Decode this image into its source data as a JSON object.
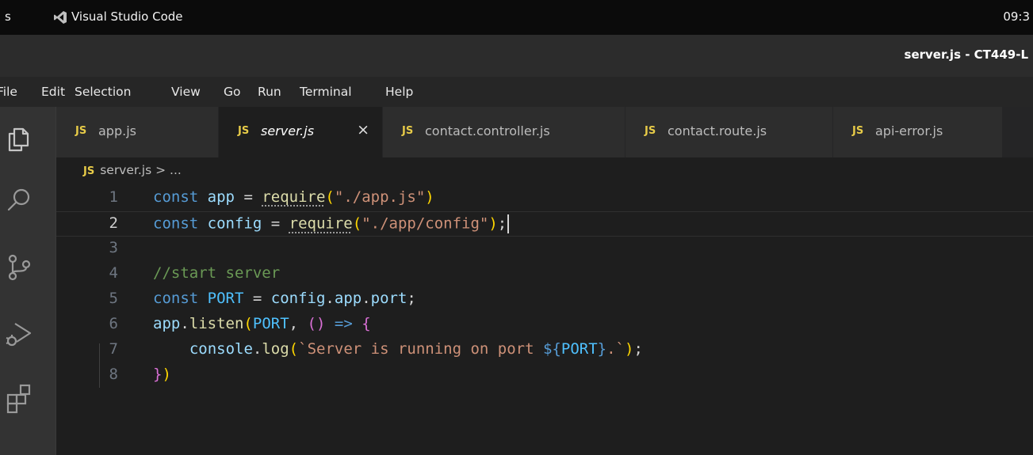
{
  "topbar": {
    "activities": "s",
    "app_name": "Visual Studio Code",
    "clock": "09:3"
  },
  "window": {
    "title": "server.js - CT449-L"
  },
  "menu": [
    "File",
    "Edit",
    "Selection",
    "View",
    "Go",
    "Run",
    "Terminal",
    "Help"
  ],
  "tabs": [
    {
      "lang": "JS",
      "name": "app.js",
      "active": false
    },
    {
      "lang": "JS",
      "name": "server.js",
      "active": true,
      "close": "×"
    },
    {
      "lang": "JS",
      "name": "contact.controller.js",
      "active": false
    },
    {
      "lang": "JS",
      "name": "contact.route.js",
      "active": false
    },
    {
      "lang": "JS",
      "name": "api-error.js",
      "active": false
    }
  ],
  "breadcrumb": {
    "lang": "JS",
    "file": "server.js",
    "separator": ">",
    "rest": "..."
  },
  "editor": {
    "cursor_line": 2,
    "lines": [
      {
        "n": "1",
        "text": "const app = require(\"./app.js\")"
      },
      {
        "n": "2",
        "text": "const config = require(\"./app/config\");"
      },
      {
        "n": "3",
        "text": ""
      },
      {
        "n": "4",
        "text": "//start server"
      },
      {
        "n": "5",
        "text": "const PORT = config.app.port;"
      },
      {
        "n": "6",
        "text": "app.listen(PORT, () => {"
      },
      {
        "n": "7",
        "text": "    console.log(`Server is running on port ${PORT}.`);"
      },
      {
        "n": "8",
        "text": "})"
      }
    ]
  },
  "activity_icons": [
    "explorer-icon",
    "search-icon",
    "source-control-icon",
    "run-debug-icon",
    "extensions-icon"
  ],
  "colors": {
    "keyword": "#569cd6",
    "variable": "#9cdcfe",
    "constant": "#4fc1ff",
    "function": "#dcdcaa",
    "string": "#ce9178",
    "comment": "#6a9955",
    "js_badge": "#e7cb48"
  }
}
